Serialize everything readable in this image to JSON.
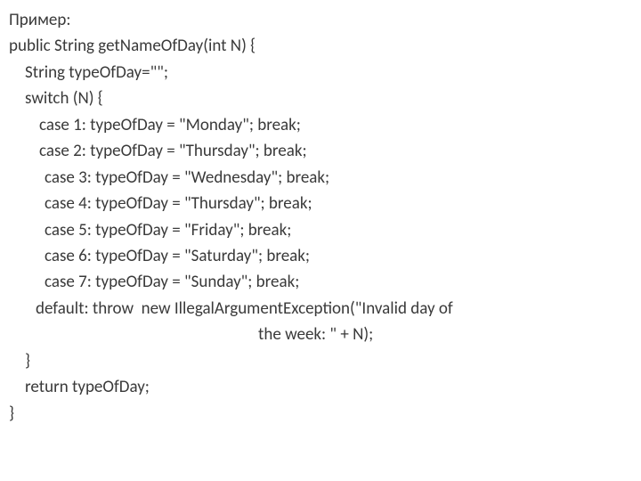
{
  "code": {
    "l0": "Пример:",
    "l1": "public String getNameOfDay(int N) {",
    "l2": "String typeOfDay=\"\";",
    "l3": "switch (N) {",
    "l4": "case 1: typeOfDay = \"Monday\"; break;",
    "l5": "case 2: typeOfDay = \"Thursday\"; break;",
    "l6": "case 3: typeOfDay = \"Wednesday\"; break;",
    "l7": "case 4: typeOfDay = \"Thursday\"; break;",
    "l8": "case 5: typeOfDay = \"Friday\"; break;",
    "l9": "case 6: typeOfDay = \"Saturday\"; break;",
    "l10": "case 7: typeOfDay = \"Sunday\"; break;",
    "l11": "default: throw  new IllegalArgumentException(\"Invalid day of",
    "l12": "the week: \" + N);",
    "l13": "}",
    "l14": "return typeOfDay;",
    "l15": "}"
  }
}
